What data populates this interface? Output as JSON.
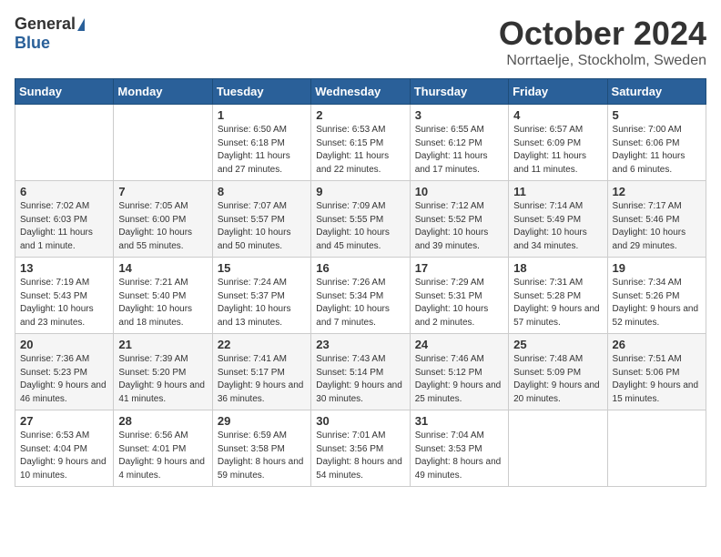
{
  "header": {
    "logo_general": "General",
    "logo_blue": "Blue",
    "month": "October 2024",
    "location": "Norrtaelje, Stockholm, Sweden"
  },
  "days_of_week": [
    "Sunday",
    "Monday",
    "Tuesday",
    "Wednesday",
    "Thursday",
    "Friday",
    "Saturday"
  ],
  "weeks": [
    [
      {
        "day": "",
        "detail": ""
      },
      {
        "day": "",
        "detail": ""
      },
      {
        "day": "1",
        "detail": "Sunrise: 6:50 AM\nSunset: 6:18 PM\nDaylight: 11 hours and 27 minutes."
      },
      {
        "day": "2",
        "detail": "Sunrise: 6:53 AM\nSunset: 6:15 PM\nDaylight: 11 hours and 22 minutes."
      },
      {
        "day": "3",
        "detail": "Sunrise: 6:55 AM\nSunset: 6:12 PM\nDaylight: 11 hours and 17 minutes."
      },
      {
        "day": "4",
        "detail": "Sunrise: 6:57 AM\nSunset: 6:09 PM\nDaylight: 11 hours and 11 minutes."
      },
      {
        "day": "5",
        "detail": "Sunrise: 7:00 AM\nSunset: 6:06 PM\nDaylight: 11 hours and 6 minutes."
      }
    ],
    [
      {
        "day": "6",
        "detail": "Sunrise: 7:02 AM\nSunset: 6:03 PM\nDaylight: 11 hours and 1 minute."
      },
      {
        "day": "7",
        "detail": "Sunrise: 7:05 AM\nSunset: 6:00 PM\nDaylight: 10 hours and 55 minutes."
      },
      {
        "day": "8",
        "detail": "Sunrise: 7:07 AM\nSunset: 5:57 PM\nDaylight: 10 hours and 50 minutes."
      },
      {
        "day": "9",
        "detail": "Sunrise: 7:09 AM\nSunset: 5:55 PM\nDaylight: 10 hours and 45 minutes."
      },
      {
        "day": "10",
        "detail": "Sunrise: 7:12 AM\nSunset: 5:52 PM\nDaylight: 10 hours and 39 minutes."
      },
      {
        "day": "11",
        "detail": "Sunrise: 7:14 AM\nSunset: 5:49 PM\nDaylight: 10 hours and 34 minutes."
      },
      {
        "day": "12",
        "detail": "Sunrise: 7:17 AM\nSunset: 5:46 PM\nDaylight: 10 hours and 29 minutes."
      }
    ],
    [
      {
        "day": "13",
        "detail": "Sunrise: 7:19 AM\nSunset: 5:43 PM\nDaylight: 10 hours and 23 minutes."
      },
      {
        "day": "14",
        "detail": "Sunrise: 7:21 AM\nSunset: 5:40 PM\nDaylight: 10 hours and 18 minutes."
      },
      {
        "day": "15",
        "detail": "Sunrise: 7:24 AM\nSunset: 5:37 PM\nDaylight: 10 hours and 13 minutes."
      },
      {
        "day": "16",
        "detail": "Sunrise: 7:26 AM\nSunset: 5:34 PM\nDaylight: 10 hours and 7 minutes."
      },
      {
        "day": "17",
        "detail": "Sunrise: 7:29 AM\nSunset: 5:31 PM\nDaylight: 10 hours and 2 minutes."
      },
      {
        "day": "18",
        "detail": "Sunrise: 7:31 AM\nSunset: 5:28 PM\nDaylight: 9 hours and 57 minutes."
      },
      {
        "day": "19",
        "detail": "Sunrise: 7:34 AM\nSunset: 5:26 PM\nDaylight: 9 hours and 52 minutes."
      }
    ],
    [
      {
        "day": "20",
        "detail": "Sunrise: 7:36 AM\nSunset: 5:23 PM\nDaylight: 9 hours and 46 minutes."
      },
      {
        "day": "21",
        "detail": "Sunrise: 7:39 AM\nSunset: 5:20 PM\nDaylight: 9 hours and 41 minutes."
      },
      {
        "day": "22",
        "detail": "Sunrise: 7:41 AM\nSunset: 5:17 PM\nDaylight: 9 hours and 36 minutes."
      },
      {
        "day": "23",
        "detail": "Sunrise: 7:43 AM\nSunset: 5:14 PM\nDaylight: 9 hours and 30 minutes."
      },
      {
        "day": "24",
        "detail": "Sunrise: 7:46 AM\nSunset: 5:12 PM\nDaylight: 9 hours and 25 minutes."
      },
      {
        "day": "25",
        "detail": "Sunrise: 7:48 AM\nSunset: 5:09 PM\nDaylight: 9 hours and 20 minutes."
      },
      {
        "day": "26",
        "detail": "Sunrise: 7:51 AM\nSunset: 5:06 PM\nDaylight: 9 hours and 15 minutes."
      }
    ],
    [
      {
        "day": "27",
        "detail": "Sunrise: 6:53 AM\nSunset: 4:04 PM\nDaylight: 9 hours and 10 minutes."
      },
      {
        "day": "28",
        "detail": "Sunrise: 6:56 AM\nSunset: 4:01 PM\nDaylight: 9 hours and 4 minutes."
      },
      {
        "day": "29",
        "detail": "Sunrise: 6:59 AM\nSunset: 3:58 PM\nDaylight: 8 hours and 59 minutes."
      },
      {
        "day": "30",
        "detail": "Sunrise: 7:01 AM\nSunset: 3:56 PM\nDaylight: 8 hours and 54 minutes."
      },
      {
        "day": "31",
        "detail": "Sunrise: 7:04 AM\nSunset: 3:53 PM\nDaylight: 8 hours and 49 minutes."
      },
      {
        "day": "",
        "detail": ""
      },
      {
        "day": "",
        "detail": ""
      }
    ]
  ]
}
